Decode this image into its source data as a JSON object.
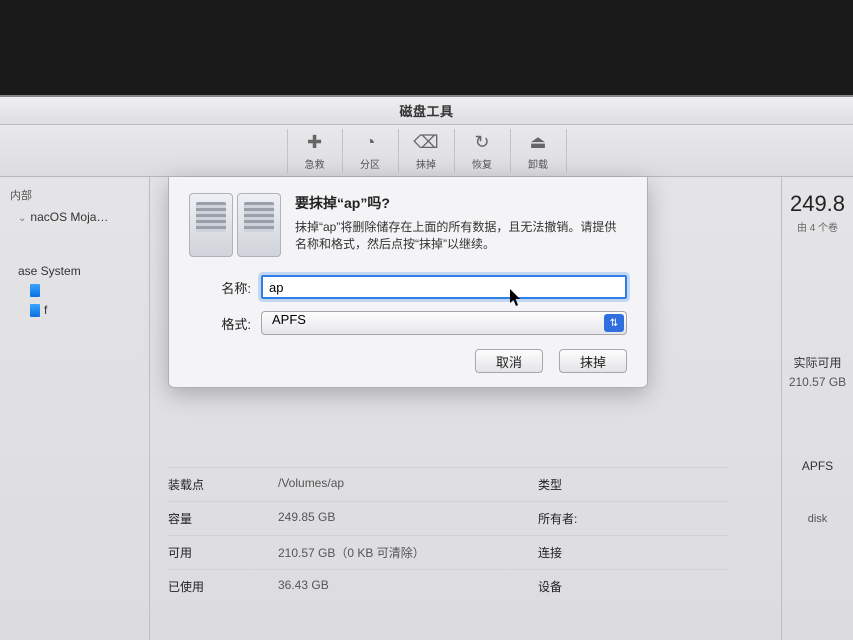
{
  "window": {
    "title": "磁盘工具"
  },
  "toolbar": {
    "items": [
      {
        "icon": "firstaid",
        "label": "急救"
      },
      {
        "icon": "partition",
        "label": "分区"
      },
      {
        "icon": "erase",
        "label": "抹掉"
      },
      {
        "icon": "restore",
        "label": "恢复"
      },
      {
        "icon": "unmount",
        "label": "卸载"
      }
    ]
  },
  "sidebar": {
    "header": "内部",
    "items": [
      {
        "label": "nacOS Moja…"
      },
      {
        "label": "ase System"
      },
      {
        "label": "f"
      }
    ]
  },
  "right": {
    "capacity": "249.8",
    "capacity_sub": "由 4 个卷",
    "avail_label": "实际可用",
    "avail_value": "210.57 GB",
    "type_label": "APFS",
    "disk_label": "disk"
  },
  "dialog": {
    "title": "要抹掉“ap”吗?",
    "description": "抹掉“ap”将删除储存在上面的所有数据，且无法撤销。请提供名称和格式，然后点按“抹掉”以继续。",
    "name_label": "名称:",
    "name_value": "ap",
    "format_label": "格式:",
    "format_value": "APFS",
    "cancel": "取消",
    "erase": "抹掉"
  },
  "details": {
    "rows": [
      {
        "k": "装载点",
        "v": "/Volumes/ap",
        "k2": "类型"
      },
      {
        "k": "容量",
        "v": "249.85 GB",
        "k2": "所有者:"
      },
      {
        "k": "可用",
        "v": "210.57 GB（0 KB 可清除）",
        "k2": "连接"
      },
      {
        "k": "已使用",
        "v": "36.43 GB",
        "k2": "设备"
      }
    ]
  }
}
